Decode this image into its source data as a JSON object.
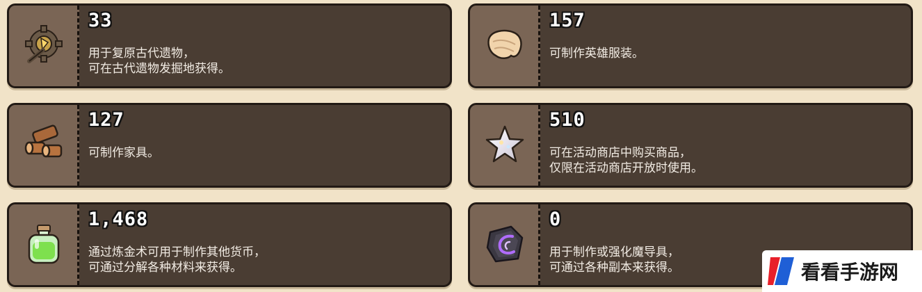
{
  "items": [
    {
      "name": "relic-tool",
      "count": "33",
      "description": "用于复原古代遗物，\n可在古代遗物发掘地获得。"
    },
    {
      "name": "cloth",
      "count": "157",
      "description": "可制作英雄服装。"
    },
    {
      "name": "wood",
      "count": "127",
      "description": "可制作家具。"
    },
    {
      "name": "star-stone",
      "count": "510",
      "description": "可在活动商店中购买商品，\n仅限在活动商店开放时使用。"
    },
    {
      "name": "alchemy-potion",
      "count": "1,468",
      "description": "通过炼金术可用于制作其他货币，\n可通过分解各种材料来获得。"
    },
    {
      "name": "magic-rune-stone",
      "count": "0",
      "description": "用于制作或强化魔导具，\n可通过各种副本来获得。"
    }
  ],
  "watermark": {
    "text": "看看手游网"
  },
  "colors": {
    "card_bg": "#4a3d33",
    "icon_bg": "#7a6555",
    "page_bg": "#f1e3c8"
  }
}
